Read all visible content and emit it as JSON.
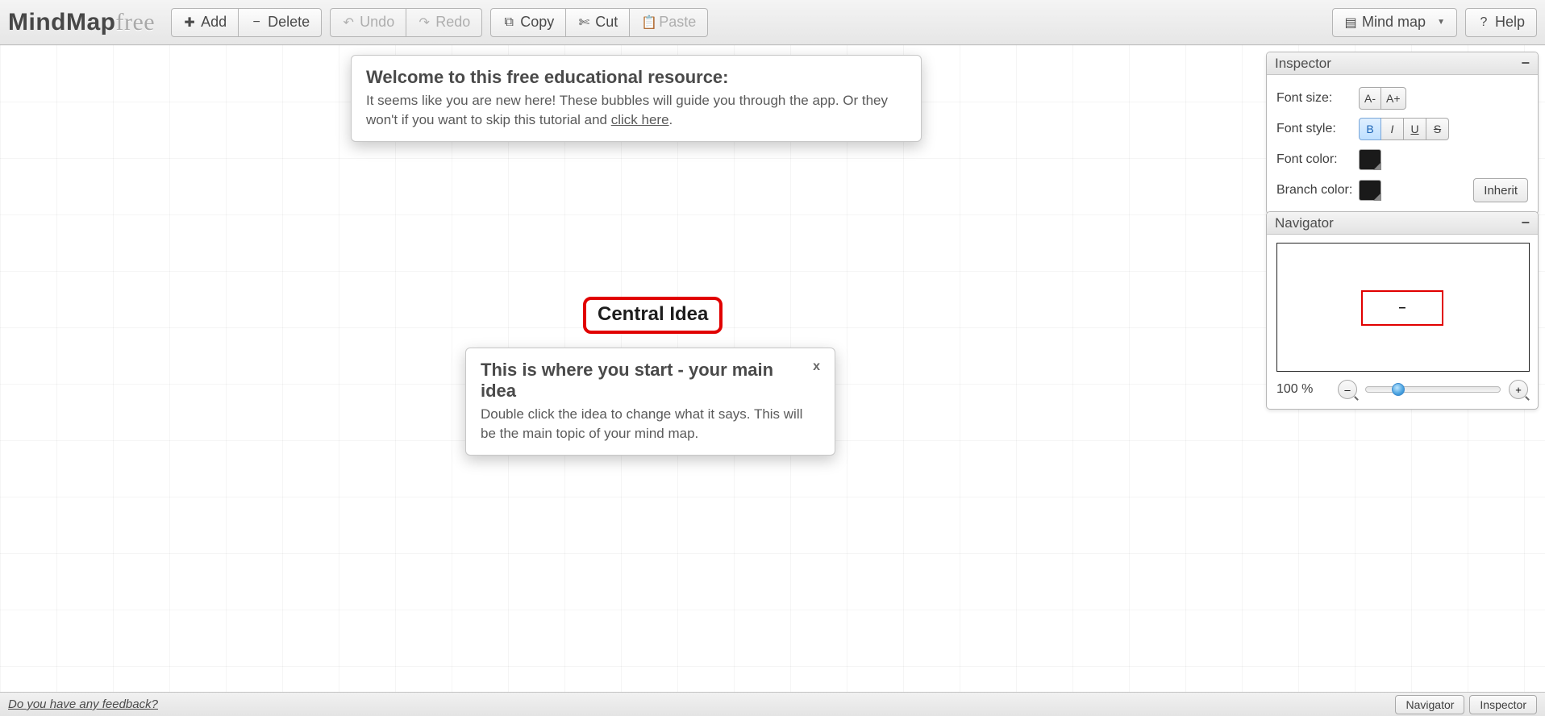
{
  "app": {
    "logo_main": "MindMap",
    "logo_free": "free"
  },
  "toolbar": {
    "add": "Add",
    "delete": "Delete",
    "undo": "Undo",
    "redo": "Redo",
    "copy": "Copy",
    "cut": "Cut",
    "paste": "Paste",
    "mindmap": "Mind map",
    "help": "Help"
  },
  "welcome": {
    "title": "Welcome to this free educational resource:",
    "body_a": "It seems like you are new here! These bubbles will guide you through the app. Or they won't if you want to skip this tutorial and ",
    "link": "click here",
    "body_b": "."
  },
  "start": {
    "title": "This is where you start - your main idea",
    "close": "x",
    "body": "Double click the idea to change what it says. This will be the main topic of your mind map."
  },
  "node": {
    "label": "Central Idea"
  },
  "inspector": {
    "title": "Inspector",
    "font_size_label": "Font size:",
    "font_size_dec": "A-",
    "font_size_inc": "A+",
    "font_style_label": "Font style:",
    "bold": "B",
    "italic": "I",
    "underline": "U",
    "strike": "S",
    "font_color_label": "Font color:",
    "branch_color_label": "Branch color:",
    "inherit": "Inherit",
    "font_color": "#1a1a1a",
    "branch_color": "#1a1a1a"
  },
  "navigator": {
    "title": "Navigator",
    "zoom": "100 %",
    "zoom_out_glyph": "–",
    "zoom_in_glyph": "+"
  },
  "footer": {
    "feedback": "Do you have any feedback?",
    "navigator": "Navigator",
    "inspector": "Inspector"
  }
}
